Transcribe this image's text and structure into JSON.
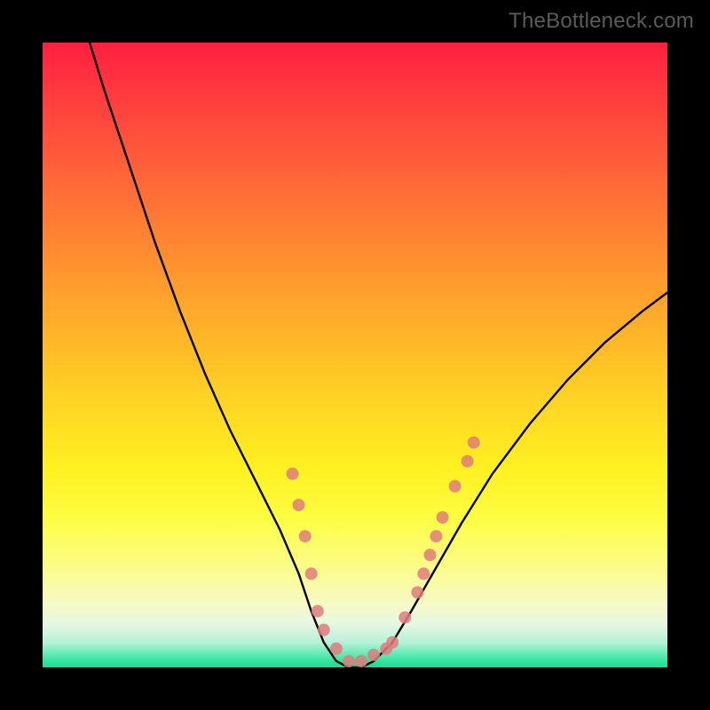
{
  "watermark": "TheBottleneck.com",
  "colors": {
    "background": "#000000",
    "gradient_top": "#ff1e40",
    "gradient_bottom": "#18db92",
    "curve": "#000000",
    "marker": "#e07b7b"
  },
  "chart_data": {
    "type": "line",
    "title": "",
    "xlabel": "",
    "ylabel": "",
    "xlim": [
      0,
      100
    ],
    "ylim": [
      0,
      100
    ],
    "grid": false,
    "background_gradient": "green-to-red (bottom-to-top)",
    "curve_points": [
      {
        "x": 6,
        "y": 105
      },
      {
        "x": 10,
        "y": 92
      },
      {
        "x": 14,
        "y": 80
      },
      {
        "x": 18,
        "y": 68
      },
      {
        "x": 22,
        "y": 57
      },
      {
        "x": 26,
        "y": 47
      },
      {
        "x": 30,
        "y": 38
      },
      {
        "x": 34,
        "y": 30
      },
      {
        "x": 38,
        "y": 22
      },
      {
        "x": 41,
        "y": 15
      },
      {
        "x": 43,
        "y": 9
      },
      {
        "x": 45,
        "y": 4
      },
      {
        "x": 47,
        "y": 1
      },
      {
        "x": 49,
        "y": 0
      },
      {
        "x": 51,
        "y": 0
      },
      {
        "x": 53,
        "y": 1
      },
      {
        "x": 56,
        "y": 4
      },
      {
        "x": 59,
        "y": 9
      },
      {
        "x": 63,
        "y": 16
      },
      {
        "x": 67,
        "y": 23
      },
      {
        "x": 72,
        "y": 31
      },
      {
        "x": 78,
        "y": 39
      },
      {
        "x": 84,
        "y": 46
      },
      {
        "x": 90,
        "y": 52
      },
      {
        "x": 96,
        "y": 57
      },
      {
        "x": 100,
        "y": 60
      }
    ],
    "markers": [
      {
        "x": 40,
        "y": 31
      },
      {
        "x": 41,
        "y": 26
      },
      {
        "x": 42,
        "y": 21
      },
      {
        "x": 43,
        "y": 15
      },
      {
        "x": 44,
        "y": 9
      },
      {
        "x": 45,
        "y": 6
      },
      {
        "x": 47,
        "y": 3
      },
      {
        "x": 49,
        "y": 1
      },
      {
        "x": 51,
        "y": 1
      },
      {
        "x": 53,
        "y": 2
      },
      {
        "x": 55,
        "y": 3
      },
      {
        "x": 56,
        "y": 4
      },
      {
        "x": 58,
        "y": 8
      },
      {
        "x": 60,
        "y": 12
      },
      {
        "x": 61,
        "y": 15
      },
      {
        "x": 62,
        "y": 18
      },
      {
        "x": 63,
        "y": 21
      },
      {
        "x": 64,
        "y": 24
      },
      {
        "x": 66,
        "y": 29
      },
      {
        "x": 68,
        "y": 33
      },
      {
        "x": 69,
        "y": 36
      }
    ]
  }
}
